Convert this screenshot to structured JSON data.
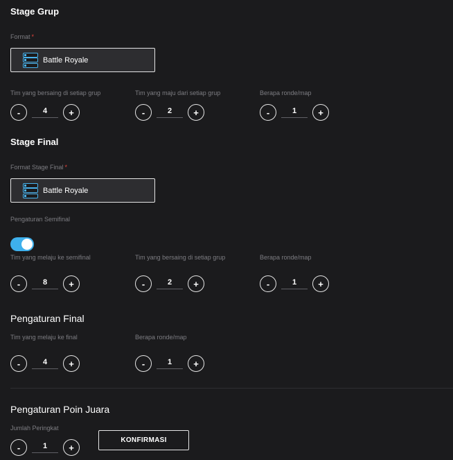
{
  "stage_grup": {
    "title": "Stage Grup",
    "format_label": "Format",
    "required_mark": "*",
    "format_value": "Battle Royale",
    "steppers": [
      {
        "label": "Tim yang bersaing di setiap grup",
        "value": "4"
      },
      {
        "label": "Tim yang maju dari setiap grup",
        "value": "2"
      },
      {
        "label": "Berapa ronde/map",
        "value": "1"
      }
    ]
  },
  "stage_final": {
    "title": "Stage Final",
    "format_label": "Format Stage Final",
    "required_mark": "*",
    "format_value": "Battle Royale",
    "semifinal_label": "Pengaturan Semifinal",
    "semifinal_enabled": true,
    "steppers": [
      {
        "label": "Tim yang melaju ke semifinal",
        "value": "8"
      },
      {
        "label": "Tim yang bersaing di setiap grup",
        "value": "2"
      },
      {
        "label": "Berapa ronde/map",
        "value": "1"
      }
    ]
  },
  "final": {
    "title": "Pengaturan Final",
    "steppers": [
      {
        "label": "Tim yang melaju ke final",
        "value": "4"
      },
      {
        "label": "Berapa ronde/map",
        "value": "1"
      }
    ]
  },
  "poin_juara": {
    "title": "Pengaturan Poin Juara",
    "stepper": {
      "label": "Jumlah Peringkat",
      "value": "1"
    },
    "confirm_label": "KONFIRMASI"
  },
  "controls": {
    "minus": "-",
    "plus": "+"
  },
  "colors": {
    "background": "#1b1b1d",
    "accent": "#3eb0ec",
    "required": "#e0443c"
  },
  "icons": {
    "format_select": "battle-royale-list-icon"
  }
}
